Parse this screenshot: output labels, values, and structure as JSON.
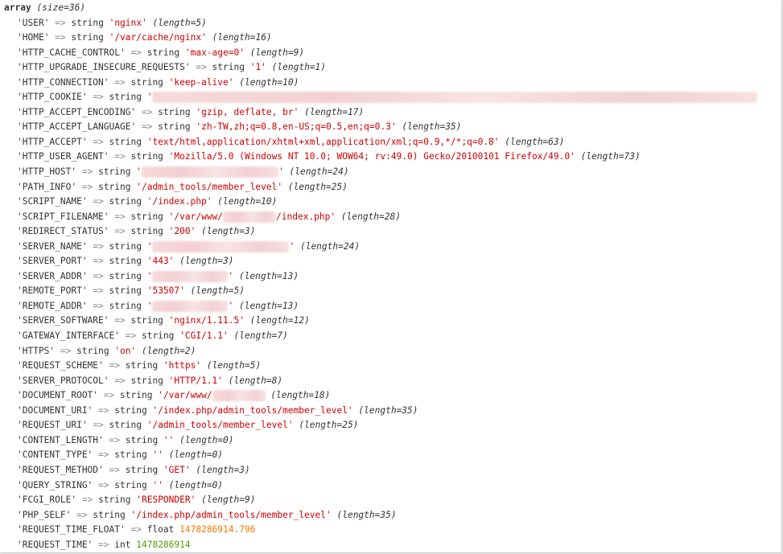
{
  "header": {
    "keyword": "array",
    "size_text": "(size=36)"
  },
  "arrow": "=>",
  "rows": [
    {
      "key": "'USER'",
      "type": "string",
      "value": "'nginx'",
      "length": "(length=5)"
    },
    {
      "key": "'HOME'",
      "type": "string",
      "value": "'/var/cache/nginx'",
      "length": "(length=16)"
    },
    {
      "key": "'HTTP_CACHE_CONTROL'",
      "type": "string",
      "value": "'max-age=0'",
      "length": "(length=9)"
    },
    {
      "key": "'HTTP_UPGRADE_INSECURE_REQUESTS'",
      "type": "string",
      "value": "'1'",
      "length": "(length=1)"
    },
    {
      "key": "'HTTP_CONNECTION'",
      "type": "string",
      "value": "'keep-alive'",
      "length": "(length=10)"
    },
    {
      "key": "'HTTP_COOKIE'",
      "type": "string",
      "value": "'",
      "length": "",
      "redacted": true
    },
    {
      "key": "'HTTP_ACCEPT_ENCODING'",
      "type": "string",
      "value": "'gzip, deflate, br'",
      "length": "(length=17)"
    },
    {
      "key": "'HTTP_ACCEPT_LANGUAGE'",
      "type": "string",
      "value": "'zh-TW,zh;q=0.8,en-US;q=0.5,en;q=0.3'",
      "length": "(length=35)"
    },
    {
      "key": "'HTTP_ACCEPT'",
      "type": "string",
      "value": "'text/html,application/xhtml+xml,application/xml;q=0.9,*/*;q=0.8'",
      "length": "(length=63)"
    },
    {
      "key": "'HTTP_USER_AGENT'",
      "type": "string",
      "value": "'Mozilla/5.0 (Windows NT 10.0; WOW64; rv:49.0) Gecko/20100101 Firefox/49.0'",
      "length": "(length=73)"
    },
    {
      "key": "'HTTP_HOST'",
      "type": "string",
      "value": "'",
      "value_end": "'",
      "length": "(length=24)",
      "redacted": true
    },
    {
      "key": "'PATH_INFO'",
      "type": "string",
      "value": "'/admin_tools/member_level'",
      "length": "(length=25)"
    },
    {
      "key": "'SCRIPT_NAME'",
      "type": "string",
      "value": "'/index.php'",
      "length": "(length=10)"
    },
    {
      "key": "'SCRIPT_FILENAME'",
      "type": "string",
      "value": "'/var/www/",
      "value_end": "/index.php'",
      "length": "(length=28)",
      "redacted": true
    },
    {
      "key": "'REDIRECT_STATUS'",
      "type": "string",
      "value": "'200'",
      "length": "(length=3)"
    },
    {
      "key": "'SERVER_NAME'",
      "type": "string",
      "value": "'",
      "value_end": "'",
      "length": "(length=24)",
      "redacted": true
    },
    {
      "key": "'SERVER_PORT'",
      "type": "string",
      "value": "'443'",
      "length": "(length=3)"
    },
    {
      "key": "'SERVER_ADDR'",
      "type": "string",
      "value": "'",
      "value_end": "'",
      "length": "(length=13)",
      "redacted": true
    },
    {
      "key": "'REMOTE_PORT'",
      "type": "string",
      "value": "'53507'",
      "length": "(length=5)"
    },
    {
      "key": "'REMOTE_ADDR'",
      "type": "string",
      "value": "'",
      "value_end": "'",
      "length": "(length=13)",
      "redacted": true
    },
    {
      "key": "'SERVER_SOFTWARE'",
      "type": "string",
      "value": "'nginx/1.11.5'",
      "length": "(length=12)"
    },
    {
      "key": "'GATEWAY_INTERFACE'",
      "type": "string",
      "value": "'CGI/1.1'",
      "length": "(length=7)"
    },
    {
      "key": "'HTTPS'",
      "type": "string",
      "value": "'on'",
      "length": "(length=2)"
    },
    {
      "key": "'REQUEST_SCHEME'",
      "type": "string",
      "value": "'https'",
      "length": "(length=5)"
    },
    {
      "key": "'SERVER_PROTOCOL'",
      "type": "string",
      "value": "'HTTP/1.1'",
      "length": "(length=8)"
    },
    {
      "key": "'DOCUMENT_ROOT'",
      "type": "string",
      "value": "'/var/www/",
      "value_end": "",
      "length": "(length=18)",
      "redacted": true
    },
    {
      "key": "'DOCUMENT_URI'",
      "type": "string",
      "value": "'/index.php/admin_tools/member_level'",
      "length": "(length=35)"
    },
    {
      "key": "'REQUEST_URI'",
      "type": "string",
      "value": "'/admin_tools/member_level'",
      "length": "(length=25)"
    },
    {
      "key": "'CONTENT_LENGTH'",
      "type": "string",
      "value": "''",
      "length": "(length=0)"
    },
    {
      "key": "'CONTENT_TYPE'",
      "type": "string",
      "value": "''",
      "length": "(length=0)"
    },
    {
      "key": "'REQUEST_METHOD'",
      "type": "string",
      "value": "'GET'",
      "length": "(length=3)"
    },
    {
      "key": "'QUERY_STRING'",
      "type": "string",
      "value": "''",
      "length": "(length=0)"
    },
    {
      "key": "'FCGI_ROLE'",
      "type": "string",
      "value": "'RESPONDER'",
      "length": "(length=9)"
    },
    {
      "key": "'PHP_SELF'",
      "type": "string",
      "value": "'/index.php/admin_tools/member_level'",
      "length": "(length=35)"
    },
    {
      "key": "'REQUEST_TIME_FLOAT'",
      "type": "float",
      "value": "1478286914.796",
      "length": ""
    },
    {
      "key": "'REQUEST_TIME'",
      "type": "int",
      "value": "1478286914",
      "length": ""
    }
  ],
  "colors": {
    "string": "#cc0000",
    "float": "#f57900",
    "int": "#4e9a06",
    "arrow": "#888a85",
    "text": "#333333"
  }
}
